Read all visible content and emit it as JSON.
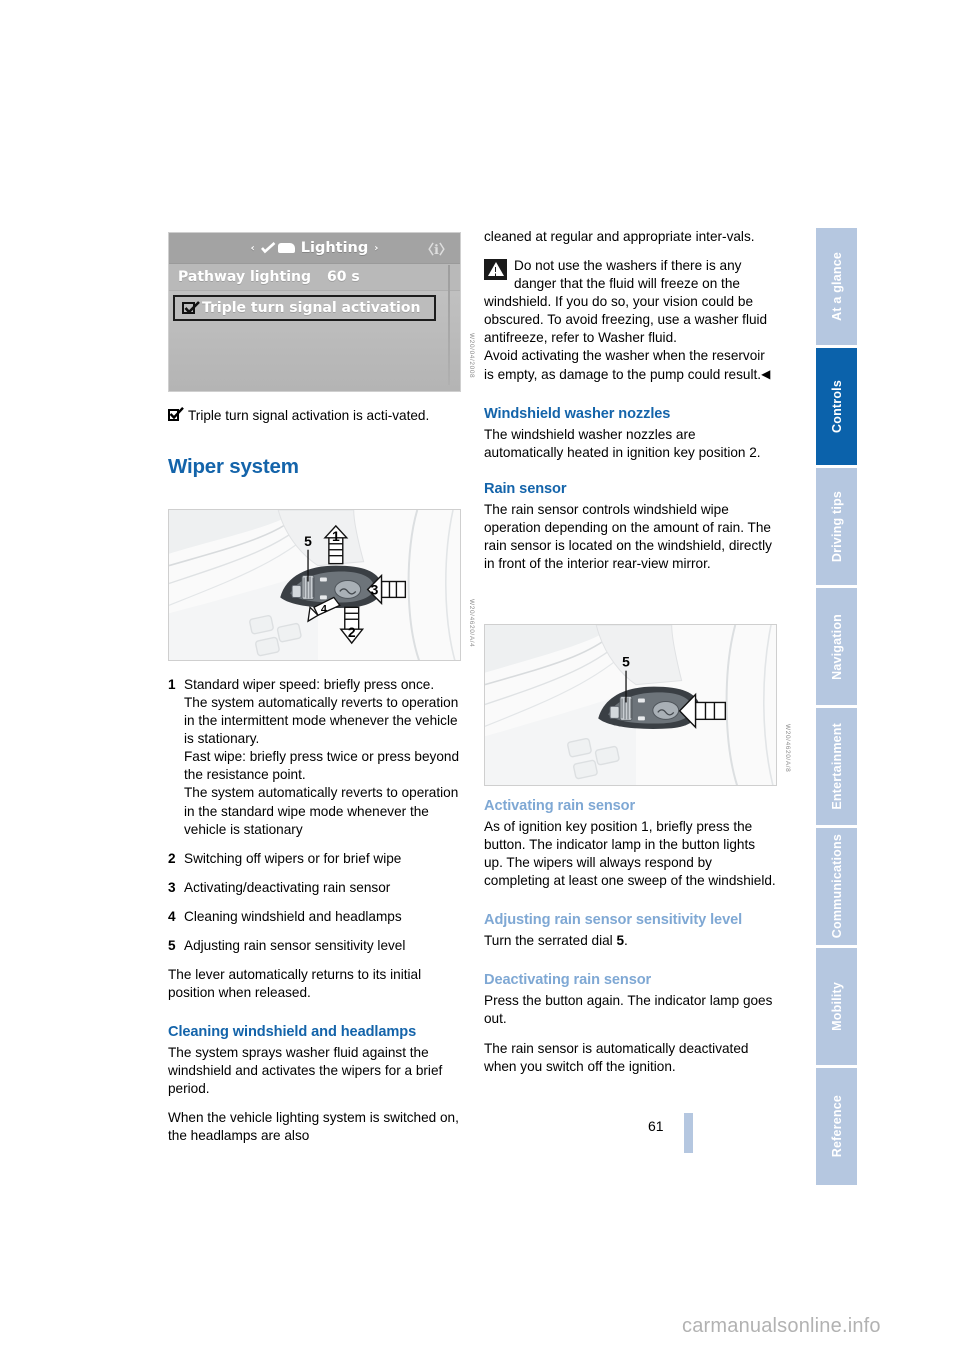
{
  "page": {
    "number": "61",
    "watermark": "carmanualsonline.info"
  },
  "sidebar": {
    "tabs": [
      {
        "label": "At a glance",
        "active": false
      },
      {
        "label": "Controls",
        "active": true
      },
      {
        "label": "Driving tips",
        "active": false
      },
      {
        "label": "Navigation",
        "active": false
      },
      {
        "label": "Entertainment",
        "active": false
      },
      {
        "label": "Communications",
        "active": false
      },
      {
        "label": "Mobility",
        "active": false
      },
      {
        "label": "Reference",
        "active": false
      }
    ],
    "active_color": "#0b62ab",
    "inactive_color": "#b5c7e0"
  },
  "left_column": {
    "idrive_screen": {
      "title": "Lighting",
      "left_arrow": "‹",
      "right_arrow": "›",
      "info_icon": "info-icon",
      "rows": [
        {
          "label": "Pathway lighting",
          "value": "60 s"
        }
      ],
      "selected_item": "Triple turn signal activation"
    },
    "checkbox_note": "Triple turn signal activation is acti-vated.",
    "section_heading": "Wiper system",
    "figure_caption_code": "",
    "numbered_items": [
      {
        "number": "1",
        "text": "Standard wiper speed: briefly press once.\nThe system automatically reverts to operation in the intermittent mode whenever the vehicle is stationary.\nFast wipe: briefly press twice or press beyond the resistance point.\nThe system automatically reverts to operation in the standard wipe mode whenever the vehicle is stationary"
      },
      {
        "number": "2",
        "text": "Switching off wipers or for brief wipe"
      },
      {
        "number": "3",
        "text": "Activating/deactivating rain sensor"
      },
      {
        "number": "4",
        "text": "Cleaning windshield and headlamps"
      },
      {
        "number": "5",
        "text": "Adjusting rain sensor sensitivity level"
      }
    ],
    "lever_note": "The lever automatically returns to its initial position when released.",
    "cleaning_heading": "Cleaning windshield and headlamps",
    "cleaning_para1": "The system sprays washer fluid against the windshield and activates the wipers for a brief period.",
    "cleaning_para2": "When the vehicle lighting system is switched on, the headlamps are also"
  },
  "right_column": {
    "continuation": "cleaned at regular and appropriate inter-vals.",
    "warning": {
      "icon": "warning-triangle-icon",
      "text": "Do not use the washers if there is any danger that the fluid will freeze on the windshield. If you do so, your vision could be obscured. To avoid freezing, use a washer fluid antifreeze, refer to Washer fluid.\nAvoid activating the washer when the reservoir is empty, as damage to the pump could result.",
      "end_marker": "◀"
    },
    "nozzles_heading": "Windshield washer nozzles",
    "nozzles_text": "The windshield washer nozzles are automatically heated in ignition key position 2.",
    "rain_sensor_heading": "Rain sensor",
    "rain_sensor_text": "The rain sensor controls windshield wipe operation depending on the amount of rain. The rain sensor is located on the windshield, directly in front of the interior rear-view mirror.",
    "activating_heading": "Activating rain sensor",
    "activating_text": "As of ignition key position 1, briefly press the button. The indicator lamp in the button lights up. The wipers will always respond by completing at least one sweep of the windshield.",
    "adjusting_heading": "Adjusting rain sensor sensitivity level",
    "adjusting_text_pre": "Turn the serrated dial ",
    "adjusting_text_bold": "5",
    "adjusting_text_post": ".",
    "deactivating_heading": "Deactivating rain sensor",
    "deactivating_para1": "Press the button again. The indicator lamp goes out.",
    "deactivating_para2": "The rain sensor is automatically deactivated when you switch off the ignition."
  },
  "figures": {
    "stalk_full": {
      "name": "wiper-stalk-diagram",
      "callouts": [
        "1",
        "2",
        "3",
        "5"
      ]
    },
    "stalk_rain": {
      "name": "rain-sensor-button-diagram",
      "callouts": [
        "5"
      ]
    }
  }
}
